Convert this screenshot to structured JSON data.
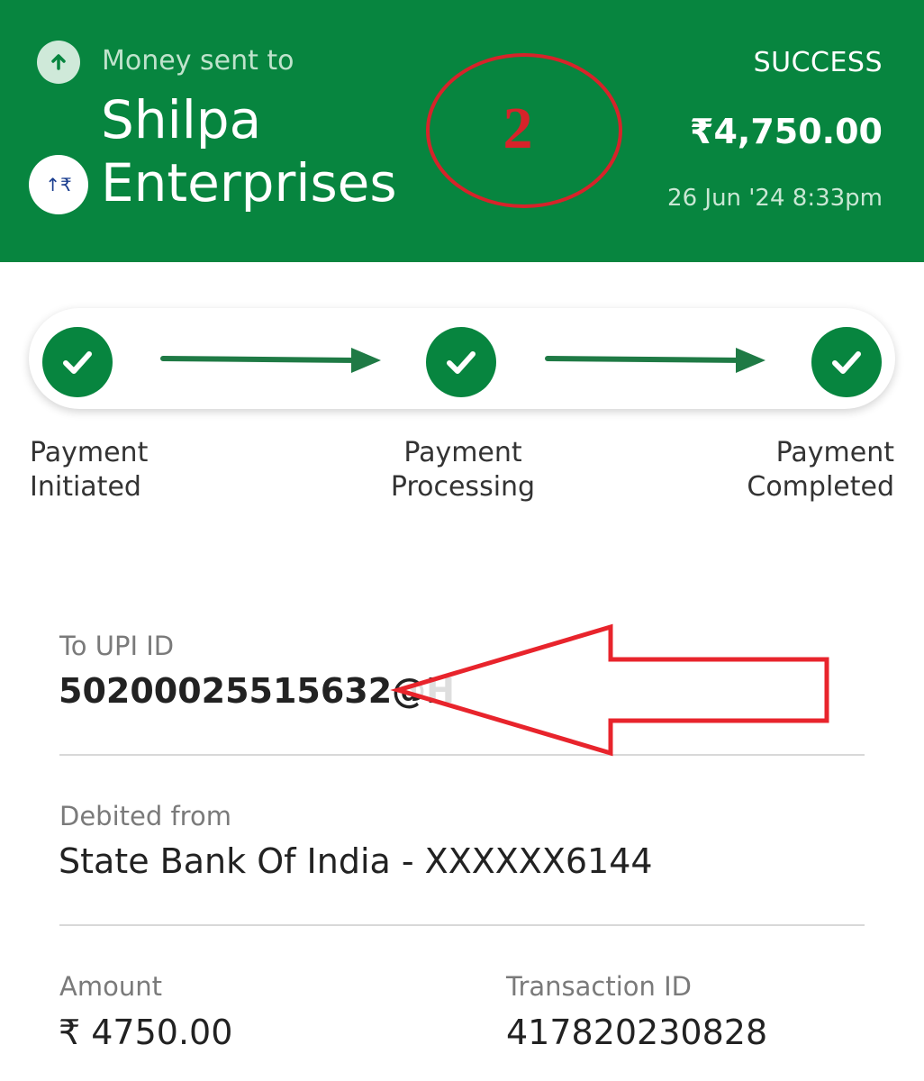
{
  "header": {
    "money_sent_label": "Money sent to",
    "payee_line1": "Shilpa",
    "payee_line2": "Enterprises",
    "status": "SUCCESS",
    "amount": "₹4,750.00",
    "datetime": "26 Jun '24 8:33pm",
    "upi_badge_text": "↑₹",
    "accent_color": "#07853f"
  },
  "annotation": {
    "number": "2",
    "color": "#d7232a"
  },
  "steps": [
    {
      "line1": "Payment",
      "line2": "Initiated"
    },
    {
      "line1": "Payment",
      "line2": "Processing"
    },
    {
      "line1": "Payment",
      "line2": "Completed"
    }
  ],
  "details": {
    "upi_label": "To UPI ID",
    "upi_value": "50200025515632@H",
    "debited_label": "Debited from",
    "debited_value": "State Bank Of India - XXXXXX6144",
    "amount_label": "Amount",
    "amount_value": "₹ 4750.00",
    "txn_label": "Transaction ID",
    "txn_value": "417820230828"
  },
  "icons": [
    "arrow-up-icon",
    "upi-rupee-icon",
    "checkmark-icon",
    "right-arrow-icon"
  ]
}
